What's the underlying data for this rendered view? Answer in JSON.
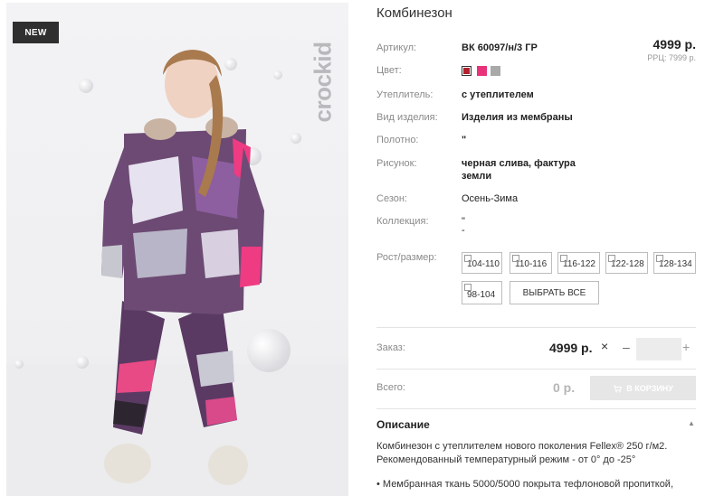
{
  "photo": {
    "badge": "NEW",
    "brand": "crockid"
  },
  "product": {
    "title": "Комбинезон",
    "price": "4999 р.",
    "rrc": "РРЦ: 7999 р."
  },
  "attributes": {
    "article": {
      "label": "Артикул:",
      "value": "ВК 60097/н/3 ГР"
    },
    "color": {
      "label": "Цвет:",
      "swatches": [
        "#b5202e",
        "#e8337a",
        "#a9a9a9"
      ]
    },
    "insulation": {
      "label": "Утеплитель:",
      "value": "с утеплителем"
    },
    "type": {
      "label": "Вид изделия:",
      "value": "Изделия из мембраны"
    },
    "fabric": {
      "label": "Полотно:",
      "value": "\""
    },
    "pattern": {
      "label": "Рисунок:",
      "value_line1": "черная слива, фактура",
      "value_line2": "земли"
    },
    "season": {
      "label": "Сезон:",
      "value": "Осень-Зима"
    },
    "collection": {
      "label": "Коллекция:",
      "value_line1": "\"",
      "value_line2": "-"
    }
  },
  "sizes": {
    "label": "Рост/размер:",
    "items": [
      "104-110",
      "110-116",
      "116-122",
      "122-128",
      "128-134",
      "98-104"
    ],
    "select_all": "ВЫБРАТЬ ВСЕ"
  },
  "order": {
    "label": "Заказ:",
    "price": "4999 р.",
    "x": "×",
    "minus": "–",
    "plus": "+",
    "quantity": ""
  },
  "total": {
    "label": "Всего:",
    "value": "0 р.",
    "cart_button": "В КОРЗИНУ"
  },
  "description": {
    "heading": "Описание",
    "text": "Комбинезон с утеплителем нового поколения Fellex® 250 г/м2. Рекомендованный температурный режим - от 0° до -25°",
    "bullet": "• Мембранная ткань 5000/5000 покрыта тефлоновой пропиткой,"
  }
}
